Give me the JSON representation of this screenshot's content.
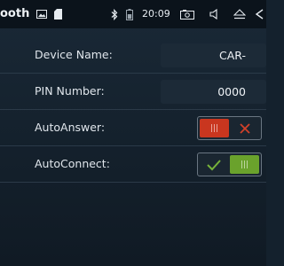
{
  "status_bar": {
    "title_partial": "ooth",
    "time": "20:09",
    "icons": [
      "image-icon",
      "sd-card-icon",
      "bluetooth-icon",
      "battery-icon",
      "camera-icon",
      "volume-icon",
      "eject-icon",
      "back-icon"
    ]
  },
  "settings": {
    "device_name": {
      "label": "Device Name:",
      "value": "CAR-"
    },
    "pin_number": {
      "label": "PIN Number:",
      "value": "0000"
    },
    "auto_answer": {
      "label": "AutoAnswer:",
      "state": "off"
    },
    "auto_connect": {
      "label": "AutoConnect:",
      "state": "on"
    }
  },
  "colors": {
    "toggle_off": "#c9361f",
    "toggle_on": "#6aa22c",
    "x_mark": "#d2402a",
    "check_mark": "#76b23a"
  }
}
